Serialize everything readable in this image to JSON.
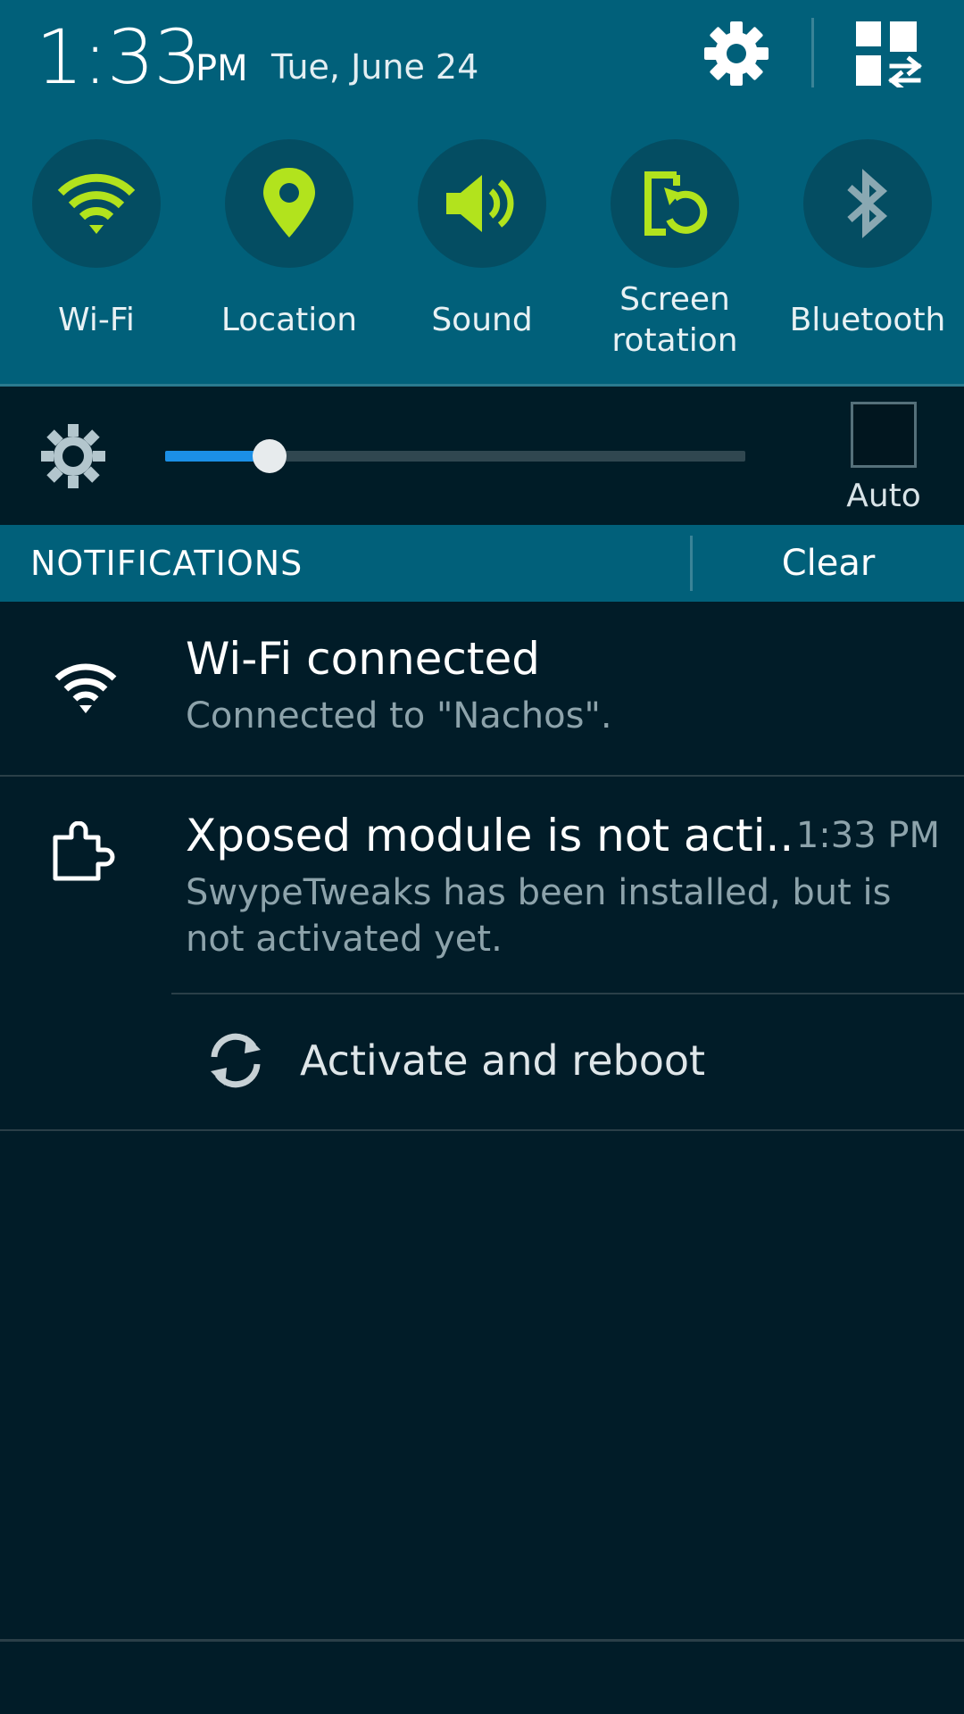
{
  "status": {
    "time": "1:33",
    "ampm": "PM",
    "date": "Tue, June 24"
  },
  "header": {
    "settings_icon": "gear-icon",
    "grid_icon": "quick-settings-grid-icon"
  },
  "toggles": [
    {
      "label": "Wi-Fi",
      "icon": "wifi-icon",
      "active": true
    },
    {
      "label": "Location",
      "icon": "location-pin-icon",
      "active": true
    },
    {
      "label": "Sound",
      "icon": "speaker-icon",
      "active": true
    },
    {
      "label": "Screen rotation",
      "icon": "screen-rotation-icon",
      "active": true
    },
    {
      "label": "Bluetooth",
      "icon": "bluetooth-icon",
      "active": false
    }
  ],
  "colors": {
    "header_bg": "#01607a",
    "active_icon": "#b2e31d",
    "inactive_icon": "#8aa8b2",
    "slider_fill": "#1b8fe6",
    "panel_bg": "#011c28"
  },
  "brightness": {
    "level": 0.18,
    "auto_label": "Auto",
    "auto_checked": false
  },
  "notifications_bar": {
    "title": "NOTIFICATIONS",
    "clear_label": "Clear"
  },
  "notifications": [
    {
      "icon": "wifi-icon",
      "title": "Wi-Fi connected",
      "text": "Connected to \"Nachos\"."
    },
    {
      "icon": "puzzle-piece-icon",
      "title": "Xposed module is not acti..",
      "time": "1:33 PM",
      "text": "SwypeTweaks has been installed, but is not activated yet.",
      "action": {
        "icon": "refresh-icon",
        "label": "Activate and reboot"
      }
    }
  ]
}
